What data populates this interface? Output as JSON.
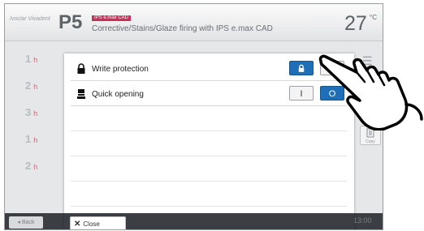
{
  "header": {
    "brand": "Ivoclar Vivadent",
    "program": "P5",
    "badge": "IPS e.max CAD",
    "title": "Corrective/Stains/Glaze firing with IPS e.max CAD",
    "temperature": "27",
    "temperature_unit": "°C"
  },
  "steps": [
    {
      "label": "1",
      "unit": "h"
    },
    {
      "label": "2",
      "unit": "h"
    },
    {
      "label": "3",
      "unit": "h"
    },
    {
      "label": "1",
      "unit": "h"
    },
    {
      "label": "2",
      "unit": "h"
    }
  ],
  "footer": {
    "back": "Back",
    "right": "13:00"
  },
  "side": {
    "menu_glyph": "☰",
    "button_label": "Copy"
  },
  "dialog": {
    "rows": [
      {
        "label": "Write protection",
        "icon": "lock-icon",
        "on_glyph": "lock-icon",
        "off_glyph": "lock-open-icon",
        "state": "on"
      },
      {
        "label": "Quick opening",
        "icon": "furnace-icon",
        "on_glyph": "I",
        "off_glyph": "O",
        "state": "off"
      }
    ],
    "close_label": "Close"
  },
  "colors": {
    "accent_blue": "#1f6fb8",
    "badge_red": "#c9305a",
    "footer_dark": "#3b3f44"
  },
  "overlay": {
    "hand_cursor": "pointing-hand-icon"
  }
}
